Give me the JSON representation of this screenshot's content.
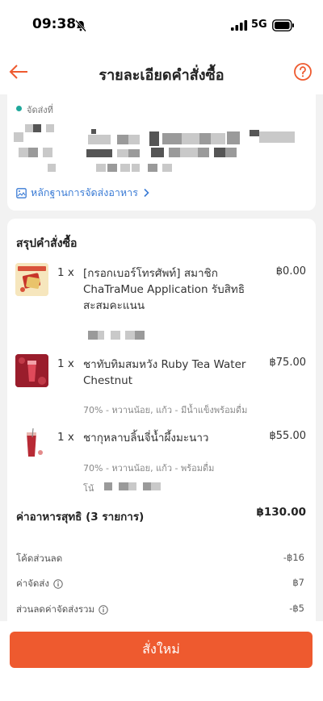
{
  "status_bar": {
    "time": "09:38",
    "network": "5G"
  },
  "header": {
    "title": "รายละเอียดคำสั่งซื้อ"
  },
  "address": {
    "label": "จัดส่งที่",
    "proof_link": "หลักฐานการจัดส่งอาหาร"
  },
  "summary": {
    "title": "สรุปคำสั่งซื้อ",
    "items": [
      {
        "qty": "1 x",
        "name": "[กรอกเบอร์โทรศัพท์] สมาชิก ChaTraMue Application รับสิทธิสะสมคะแนน",
        "price": "฿0.00",
        "options": ""
      },
      {
        "qty": "1 x",
        "name": "ชาทับทิมสมหวัง Ruby Tea Water Chestnut",
        "price": "฿75.00",
        "options": "70% - หวานน้อย, แก้ว - มีน้ำแข็งพร้อมดื่ม"
      },
      {
        "qty": "1 x",
        "name": "ชากุหลาบลิ้นจี่น้ำผึ้งมะนาว",
        "price": "฿55.00",
        "options": "70% - หวานน้อย, แก้ว - พร้อมดื่ม",
        "note_label": "โน้"
      }
    ],
    "subtotal_label": "ค่าอาหารสุทธิ (3 รายการ)",
    "subtotal_value": "฿130.00",
    "fees": [
      {
        "label": "โค้ดส่วนลด",
        "value": "-฿16",
        "info": false
      },
      {
        "label": "ค่าจัดส่ง",
        "value": "฿7",
        "info": true
      },
      {
        "label": "ส่วนลดค่าจัดส่งรวม",
        "value": "-฿5",
        "info": true
      }
    ]
  },
  "footer": {
    "reorder_label": "สั่งใหม่"
  },
  "colors": {
    "accent": "#ee5a2f",
    "link": "#3a7bd5",
    "teal": "#1fa89b"
  }
}
